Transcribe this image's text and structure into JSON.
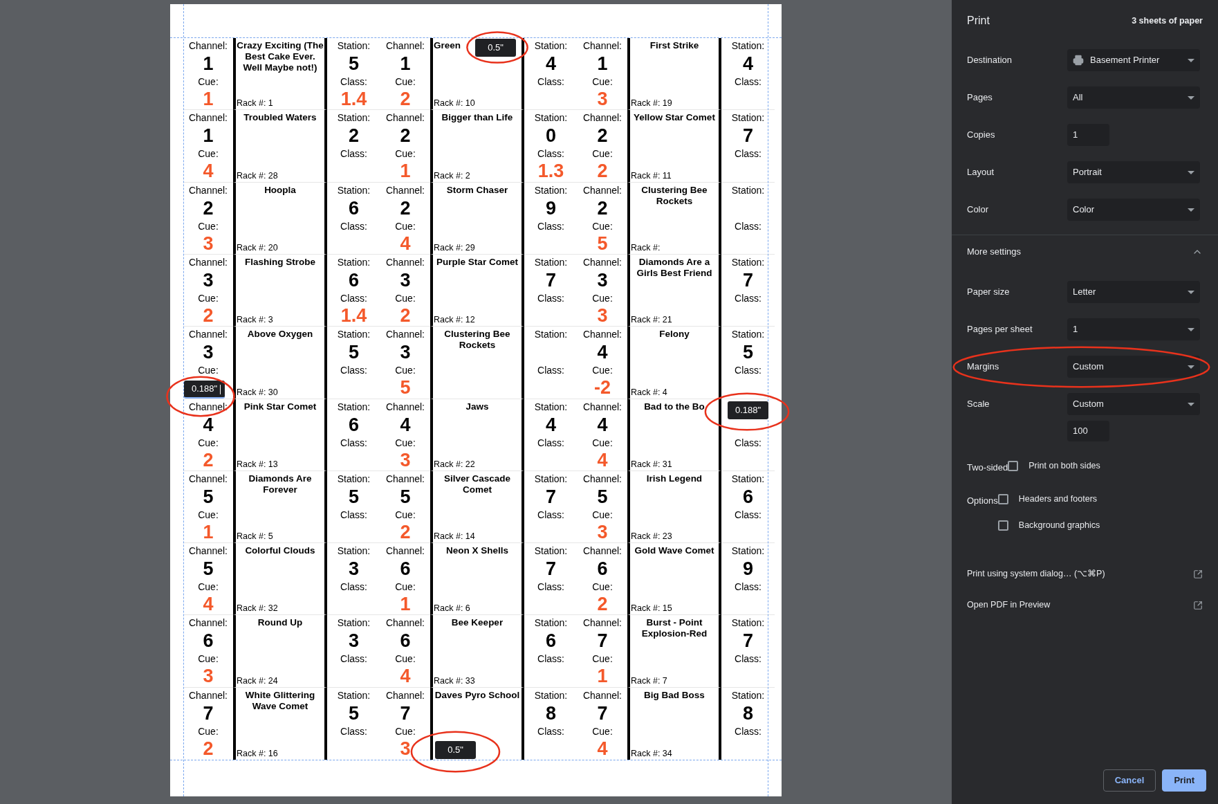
{
  "sheet": {
    "rows": [
      {
        "labels": [
          {
            "ch_label": "Channel:",
            "channel": "1",
            "cue_label": "Cue:",
            "cue": "1",
            "title": "Crazy Exciting (The Best Cake Ever. Well Maybe not!)",
            "rack": "Rack #: 1",
            "st_label": "Station:",
            "station": "5",
            "class_label": "Class:",
            "class": "1.4"
          },
          {
            "ch_label": "Channel:",
            "channel": "1",
            "cue_label": "Cue:",
            "cue": "2",
            "title": "Green",
            "truncated": true,
            "rack": "Rack #: 10",
            "st_label": "Station:",
            "station": "4",
            "class_label": "Class:"
          },
          {
            "ch_label": "Channel:",
            "channel": "1",
            "cue_label": "Cue:",
            "cue": "3",
            "title": "First Strike",
            "rack": "Rack #: 19",
            "st_label": "Station:",
            "station": "4",
            "class_label": "Class:"
          }
        ]
      },
      {
        "labels": [
          {
            "ch_label": "Channel:",
            "channel": "1",
            "cue_label": "Cue:",
            "cue": "4",
            "title": "Troubled Waters",
            "rack": "Rack #: 28",
            "st_label": "Station:",
            "station": "2",
            "class_label": "Class:"
          },
          {
            "ch_label": "Channel:",
            "channel": "2",
            "cue_label": "Cue:",
            "cue": "1",
            "title": "Bigger than Life",
            "rack": "Rack #: 2",
            "st_label": "Station:",
            "station": "0",
            "class_label": "Class:",
            "class": "1.3"
          },
          {
            "ch_label": "Channel:",
            "channel": "2",
            "cue_label": "Cue:",
            "cue": "2",
            "title": "Yellow Star Comet",
            "rack": "Rack #: 11",
            "st_label": "Station:",
            "station": "7",
            "class_label": "Class:"
          }
        ]
      },
      {
        "labels": [
          {
            "ch_label": "Channel:",
            "channel": "2",
            "cue_label": "Cue:",
            "cue": "3",
            "title": "Hoopla",
            "rack": "Rack #: 20",
            "st_label": "Station:",
            "station": "6",
            "class_label": "Class:"
          },
          {
            "ch_label": "Channel:",
            "channel": "2",
            "cue_label": "Cue:",
            "cue": "4",
            "title": "Storm Chaser",
            "rack": "Rack #: 29",
            "st_label": "Station:",
            "station": "9",
            "class_label": "Class:"
          },
          {
            "ch_label": "Channel:",
            "channel": "2",
            "cue_label": "Cue:",
            "cue": "5",
            "title": "Clustering Bee Rockets",
            "rack": "Rack #:",
            "st_label": "Station:",
            "class_label": "Class:"
          }
        ]
      },
      {
        "labels": [
          {
            "ch_label": "Channel:",
            "channel": "3",
            "cue_label": "Cue:",
            "cue": "2",
            "title": "Flashing Strobe",
            "rack": "Rack #: 3",
            "st_label": "Station:",
            "station": "6",
            "class_label": "Class:",
            "class": "1.4"
          },
          {
            "ch_label": "Channel:",
            "channel": "3",
            "cue_label": "Cue:",
            "cue": "2",
            "title": "Purple Star Comet",
            "rack": "Rack #: 12",
            "st_label": "Station:",
            "station": "7",
            "class_label": "Class:"
          },
          {
            "ch_label": "Channel:",
            "channel": "3",
            "cue_label": "Cue:",
            "cue": "3",
            "title": "Diamonds Are a Girls Best Friend",
            "rack": "Rack #: 21",
            "st_label": "Station:",
            "station": "7",
            "class_label": "Class:"
          }
        ]
      },
      {
        "labels": [
          {
            "ch_label": "Channel:",
            "channel": "3",
            "cue_label": "Cue:",
            "title": "Above Oxygen",
            "rack": "Rack #: 30",
            "st_label": "Station:",
            "station": "5",
            "class_label": "Class:"
          },
          {
            "ch_label": "Channel:",
            "channel": "3",
            "cue_label": "Cue:",
            "cue": "5",
            "title": "Clustering Bee Rockets",
            "st_label": "Station:",
            "class_label": "Class:"
          },
          {
            "ch_label": "Channel:",
            "channel": "4",
            "cue_label": "Cue:",
            "cue": "-2",
            "title": "Felony",
            "rack": "Rack #: 4",
            "st_label": "Station:",
            "station": "5",
            "class_label": "Class:"
          }
        ]
      },
      {
        "labels": [
          {
            "ch_label": "Channel:",
            "channel": "4",
            "cue_label": "Cue:",
            "cue": "2",
            "title": "Pink Star Comet",
            "rack": "Rack #: 13",
            "st_label": "Station:",
            "station": "6",
            "class_label": "Class:"
          },
          {
            "ch_label": "Channel:",
            "channel": "4",
            "cue_label": "Cue:",
            "cue": "3",
            "title": "Jaws",
            "rack": "Rack #: 22",
            "st_label": "Station:",
            "station": "4",
            "class_label": "Class:"
          },
          {
            "ch_label": "Channel:",
            "channel": "4",
            "cue_label": "Cue:",
            "cue": "4",
            "title": "Bad to the Bo",
            "rack": "Rack #: 31",
            "class_label": "Class:"
          }
        ]
      },
      {
        "labels": [
          {
            "ch_label": "Channel:",
            "channel": "5",
            "cue_label": "Cue:",
            "cue": "1",
            "title": "Diamonds Are Forever",
            "rack": "Rack #: 5",
            "st_label": "Station:",
            "station": "5",
            "class_label": "Class:"
          },
          {
            "ch_label": "Channel:",
            "channel": "5",
            "cue_label": "Cue:",
            "cue": "2",
            "title": "Silver Cascade Comet",
            "rack": "Rack #: 14",
            "st_label": "Station:",
            "station": "7",
            "class_label": "Class:"
          },
          {
            "ch_label": "Channel:",
            "channel": "5",
            "cue_label": "Cue:",
            "cue": "3",
            "title": "Irish Legend",
            "rack": "Rack #: 23",
            "st_label": "Station:",
            "station": "6",
            "class_label": "Class:"
          }
        ]
      },
      {
        "labels": [
          {
            "ch_label": "Channel:",
            "channel": "5",
            "cue_label": "Cue:",
            "cue": "4",
            "title": "Colorful Clouds",
            "rack": "Rack #: 32",
            "st_label": "Station:",
            "station": "3",
            "class_label": "Class:"
          },
          {
            "ch_label": "Channel:",
            "channel": "6",
            "cue_label": "Cue:",
            "cue": "1",
            "title": "Neon X Shells",
            "rack": "Rack #: 6",
            "st_label": "Station:",
            "station": "7",
            "class_label": "Class:"
          },
          {
            "ch_label": "Channel:",
            "channel": "6",
            "cue_label": "Cue:",
            "cue": "2",
            "title": "Gold Wave Comet",
            "rack": "Rack #: 15",
            "st_label": "Station:",
            "station": "9",
            "class_label": "Class:"
          }
        ]
      },
      {
        "labels": [
          {
            "ch_label": "Channel:",
            "channel": "6",
            "cue_label": "Cue:",
            "cue": "3",
            "title": "Round Up",
            "rack": "Rack #: 24",
            "st_label": "Station:",
            "station": "3",
            "class_label": "Class:"
          },
          {
            "ch_label": "Channel:",
            "channel": "6",
            "cue_label": "Cue:",
            "cue": "4",
            "title": "Bee Keeper",
            "rack": "Rack #: 33",
            "st_label": "Station:",
            "station": "6",
            "class_label": "Class:"
          },
          {
            "ch_label": "Channel:",
            "channel": "7",
            "cue_label": "Cue:",
            "cue": "1",
            "title": "Burst - Point Explosion-Red",
            "rack": "Rack #: 7",
            "st_label": "Station:",
            "station": "7",
            "class_label": "Class:"
          }
        ]
      },
      {
        "labels": [
          {
            "ch_label": "Channel:",
            "channel": "7",
            "cue_label": "Cue:",
            "cue": "2",
            "title": "White Glittering Wave Comet",
            "rack": "Rack #: 16",
            "st_label": "Station:",
            "station": "5",
            "class_label": "Class:"
          },
          {
            "ch_label": "Channel:",
            "channel": "7",
            "cue_label": "Cue:",
            "cue": "3",
            "title": "Daves Pyro School",
            "st_label": "Station:",
            "station": "8",
            "class_label": "Class:"
          },
          {
            "ch_label": "Channel:",
            "channel": "7",
            "cue_label": "Cue:",
            "cue": "4",
            "title": "Big Bad Boss",
            "rack": "Rack #: 34",
            "st_label": "Station:",
            "station": "8",
            "class_label": "Class:"
          }
        ]
      }
    ]
  },
  "margin_handles": [
    {
      "value": "0.188\"",
      "focused": true,
      "circled": true
    },
    {
      "value": "0.5\"",
      "focused": false,
      "circled": true
    },
    {
      "value": "0.188\"",
      "focused": false,
      "circled": true
    },
    {
      "value": "0.5\"",
      "focused": false,
      "circled": true
    }
  ],
  "panel": {
    "title": "Print",
    "sheet_count": "3 sheets of paper",
    "settings": [
      {
        "kind": "device",
        "label": "Destination",
        "value": "Basement Printer"
      },
      {
        "kind": "select",
        "label": "Pages",
        "value": "All"
      },
      {
        "kind": "input",
        "label": "Copies",
        "value": "1"
      },
      {
        "kind": "select",
        "label": "Layout",
        "value": "Portrait"
      },
      {
        "kind": "select",
        "label": "Color",
        "value": "Color"
      }
    ],
    "more_settings": {
      "label": "More settings",
      "expanded": true,
      "settings": [
        {
          "kind": "select",
          "label": "Paper size",
          "value": "Letter"
        },
        {
          "kind": "select",
          "label": "Pages per sheet",
          "value": "1"
        },
        {
          "kind": "select",
          "label": "Margins",
          "value": "Custom",
          "circled": true
        },
        {
          "kind": "select",
          "label": "Scale",
          "value": "Custom",
          "input_value": "100"
        },
        {
          "kind": "checkboxes",
          "label": "Two-sided",
          "options": [
            {
              "label": "Print on both sides",
              "checked": false
            }
          ]
        },
        {
          "kind": "checkboxes",
          "label": "Options",
          "options": [
            {
              "label": "Headers and footers",
              "checked": false
            },
            {
              "label": "Background graphics",
              "checked": false
            }
          ]
        }
      ]
    },
    "links": [
      "Print using system dialog… (⌥⌘P)",
      "Open PDF in Preview"
    ],
    "buttons": [
      {
        "kind": "secondary",
        "label": "Cancel"
      },
      {
        "kind": "primary",
        "label": "Print"
      }
    ]
  }
}
